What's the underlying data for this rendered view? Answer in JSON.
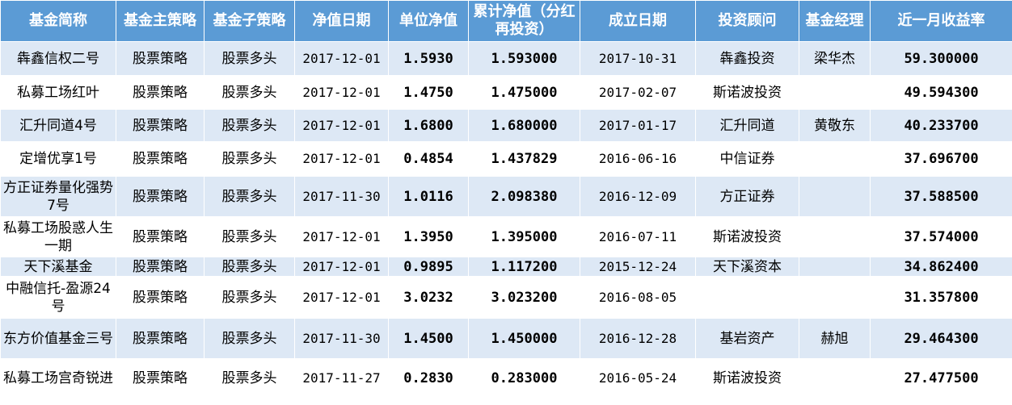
{
  "header": [
    "基金简称",
    "基金主策略",
    "基金子策略",
    "净值日期",
    "单位净值",
    "累计净值（分红再投资）",
    "成立日期",
    "投资顾问",
    "基金经理",
    "近一月收益率"
  ],
  "rows": [
    [
      "犇鑫信权二号",
      "股票策略",
      "股票多头",
      "2017-12-01",
      "1.5930",
      "1.593000",
      "2017-10-31",
      "犇鑫投资",
      "梁华杰",
      "59.300000"
    ],
    [
      "私募工场红叶",
      "股票策略",
      "股票多头",
      "2017-12-01",
      "1.4750",
      "1.475000",
      "2017-02-07",
      "斯诺波投资",
      "",
      "49.594300"
    ],
    [
      "汇升同道4号",
      "股票策略",
      "股票多头",
      "2017-12-01",
      "1.6800",
      "1.680000",
      "2017-01-17",
      "汇升同道",
      "黄敬东",
      "40.233700"
    ],
    [
      "定增优享1号",
      "股票策略",
      "股票多头",
      "2017-12-01",
      "0.4854",
      "1.437829",
      "2016-06-16",
      "中信证券",
      "",
      "37.696700"
    ],
    [
      "方正证券量化强势7号",
      "股票策略",
      "股票多头",
      "2017-11-30",
      "1.0116",
      "2.098380",
      "2016-12-09",
      "方正证券",
      "",
      "37.588500"
    ],
    [
      "私募工场股惑人生一期",
      "股票策略",
      "股票多头",
      "2017-12-01",
      "1.3950",
      "1.395000",
      "2016-07-11",
      "斯诺波投资",
      "",
      "37.574000"
    ],
    [
      "天下溪基金",
      "股票策略",
      "股票多头",
      "2017-12-01",
      "0.9895",
      "1.117200",
      "2015-12-24",
      "天下溪资本",
      "",
      "34.862400"
    ],
    [
      "中融信托-盈源24号",
      "股票策略",
      "股票多头",
      "2017-12-01",
      "3.0232",
      "3.023200",
      "2016-08-05",
      "",
      "",
      "31.357800"
    ],
    [
      "东方价值基金三号",
      "股票策略",
      "股票多头",
      "2017-11-30",
      "1.4500",
      "1.450000",
      "2016-12-28",
      "基岩资产",
      "赫旭",
      "29.464300"
    ],
    [
      "私募工场宫奇锐进",
      "股票策略",
      "股票多头",
      "2017-11-27",
      "0.2830",
      "0.283000",
      "2016-05-24",
      "斯诺波投资",
      "",
      "27.477500"
    ]
  ]
}
